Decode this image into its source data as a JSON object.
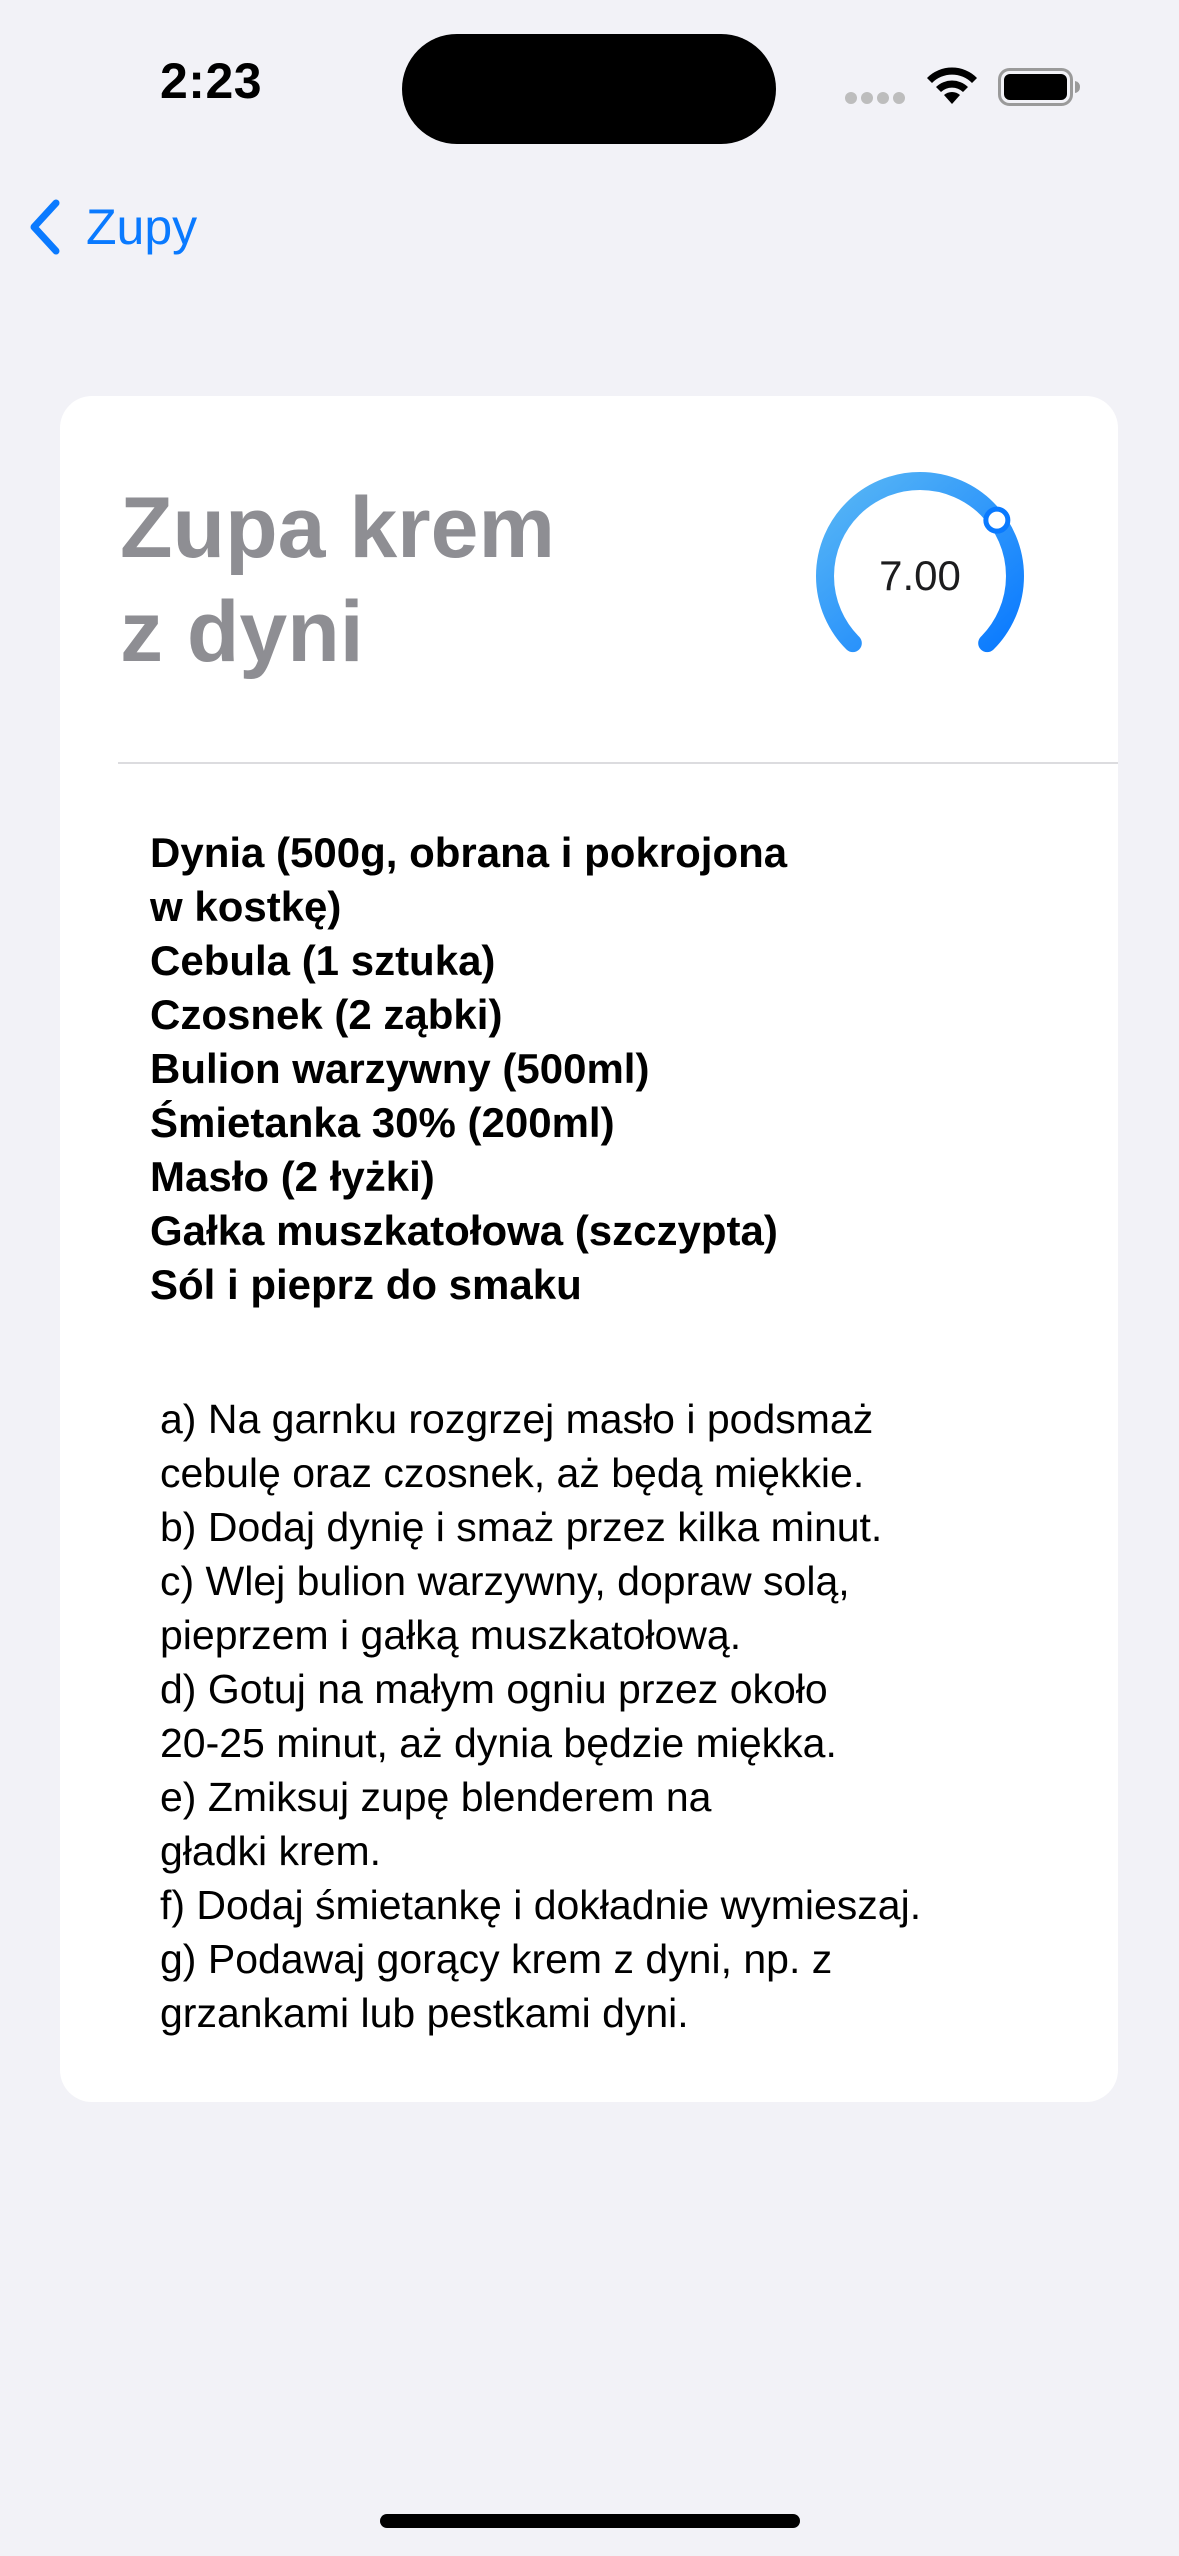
{
  "status_bar": {
    "time": "2:23"
  },
  "nav": {
    "back_label": "Zupy"
  },
  "recipe": {
    "title_line1": "Zupa krem",
    "title_line2": "z dyni",
    "rating": "7.00",
    "rating_fraction": 0.7,
    "accent_color": "#0a7aff",
    "ingredients": [
      "Dynia (500g, obrana i pokrojona",
      "w kostkę)",
      "Cebula (1 sztuka)",
      "Czosnek (2 ząbki)",
      "Bulion warzywny (500ml)",
      "Śmietanka 30% (200ml)",
      "Masło (2 łyżki)",
      "Gałka muszkatołowa (szczypta)",
      "Sól i pieprz do smaku"
    ],
    "steps": [
      "a) Na garnku rozgrzej masło i podsmaż",
      "cebulę oraz czosnek, aż będą miękkie.",
      "b) Dodaj dynię i smaż przez kilka minut.",
      "c) Wlej bulion warzywny, dopraw solą,",
      "pieprzem i gałką muszkatołową.",
      "d) Gotuj na małym ogniu przez około",
      "20-25 minut, aż dynia będzie miękka.",
      "e) Zmiksuj zupę blenderem na",
      "gładki krem.",
      "f) Dodaj śmietankę i dokładnie wymieszaj.",
      "g) Podawaj gorący krem z dyni, np. z",
      "grzankami lub pestkami dyni."
    ]
  }
}
